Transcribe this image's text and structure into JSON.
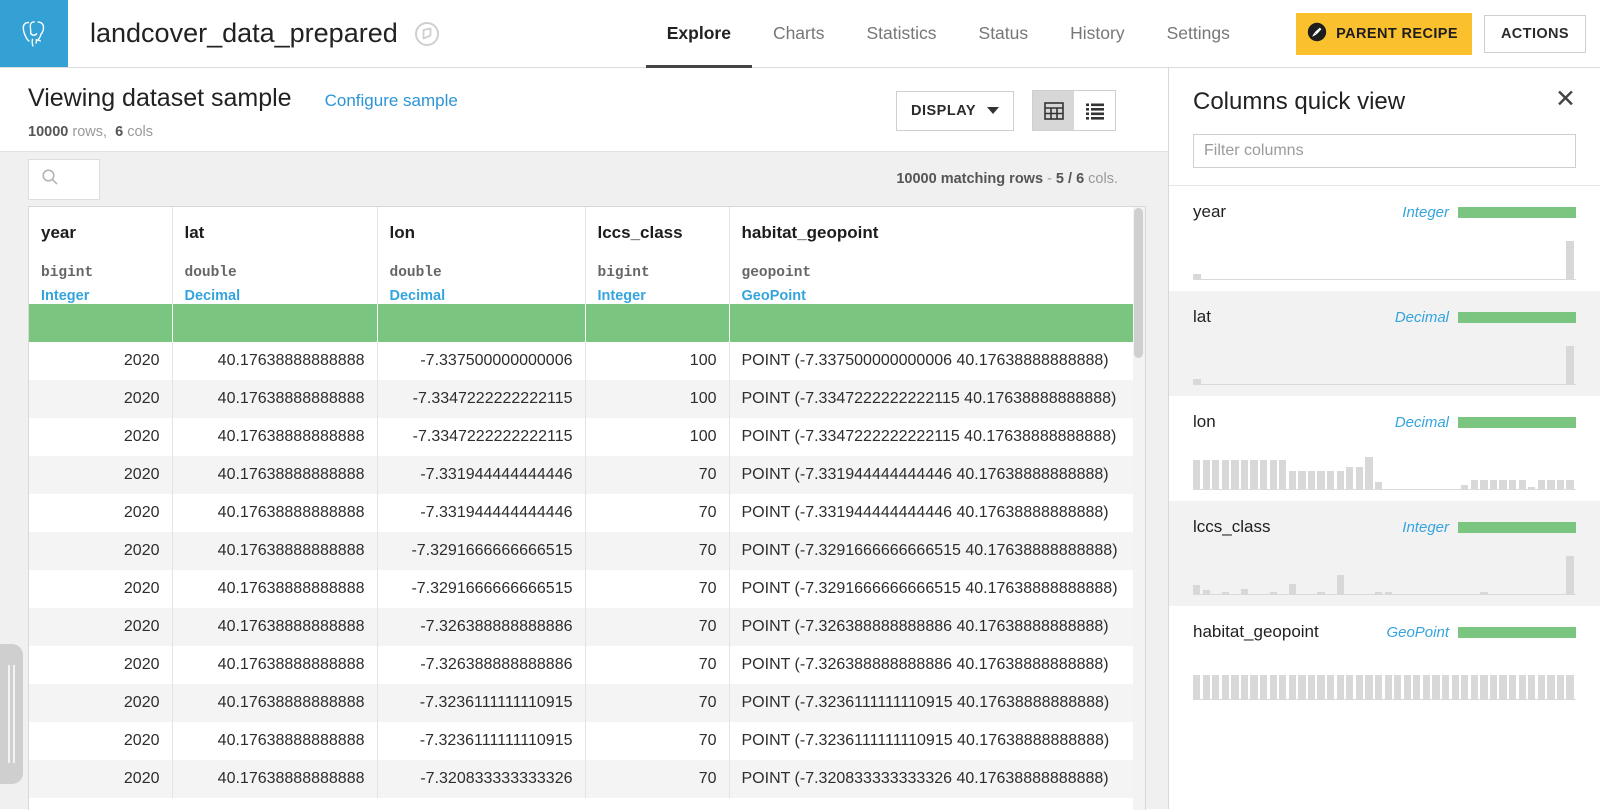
{
  "topbar": {
    "logo_icon": "postgres-elephant-icon",
    "logo_bg": "#33a1d4",
    "dataset_title": "landcover_data_prepared",
    "flag_icon": "dataset-flag-icon",
    "tabs": [
      {
        "label": "Explore",
        "active": true
      },
      {
        "label": "Charts",
        "active": false
      },
      {
        "label": "Statistics",
        "active": false
      },
      {
        "label": "Status",
        "active": false
      },
      {
        "label": "History",
        "active": false
      },
      {
        "label": "Settings",
        "active": false
      }
    ],
    "parent_recipe_label": "PARENT RECIPE",
    "parent_recipe_color": "#fbc02d",
    "actions_label": "ACTIONS"
  },
  "subheader": {
    "sample_title": "Viewing dataset sample",
    "configure_link": "Configure sample",
    "rows_count": "10000",
    "rows_word": "rows,",
    "cols_count": "6",
    "cols_word": "cols",
    "display_label": "DISPLAY",
    "view_grid_icon": "grid-view-icon",
    "view_list_icon": "list-view-icon",
    "active_view": "grid"
  },
  "toolbar": {
    "search_icon": "search-icon",
    "search_value": "",
    "matching_rows": "10000 matching rows",
    "separator": "-",
    "cols_shown": "5 / 6",
    "cols_suffix": "cols."
  },
  "table": {
    "columns": [
      {
        "name": "year",
        "sql_type": "bigint",
        "meaning": "Integer",
        "align": "num"
      },
      {
        "name": "lat",
        "sql_type": "double",
        "meaning": "Decimal",
        "align": "num"
      },
      {
        "name": "lon",
        "sql_type": "double",
        "meaning": "Decimal",
        "align": "num"
      },
      {
        "name": "lccs_class",
        "sql_type": "bigint",
        "meaning": "Integer",
        "align": "num"
      },
      {
        "name": "habitat_geopoint",
        "sql_type": "geopoint",
        "meaning": "GeoPoint",
        "align": "txt"
      }
    ],
    "quality_bar_color": "#7ac57f",
    "rows": [
      [
        "2020",
        "40.17638888888888",
        "-7.337500000000006",
        "100",
        "POINT (-7.337500000000006 40.17638888888888)"
      ],
      [
        "2020",
        "40.17638888888888",
        "-7.3347222222222115",
        "100",
        "POINT (-7.3347222222222115 40.17638888888888)"
      ],
      [
        "2020",
        "40.17638888888888",
        "-7.3347222222222115",
        "100",
        "POINT (-7.3347222222222115 40.17638888888888)"
      ],
      [
        "2020",
        "40.17638888888888",
        "-7.331944444444446",
        "70",
        "POINT (-7.331944444444446 40.17638888888888)"
      ],
      [
        "2020",
        "40.17638888888888",
        "-7.331944444444446",
        "70",
        "POINT (-7.331944444444446 40.17638888888888)"
      ],
      [
        "2020",
        "40.17638888888888",
        "-7.3291666666666515",
        "70",
        "POINT (-7.3291666666666515 40.17638888888888)"
      ],
      [
        "2020",
        "40.17638888888888",
        "-7.3291666666666515",
        "70",
        "POINT (-7.3291666666666515 40.17638888888888)"
      ],
      [
        "2020",
        "40.17638888888888",
        "-7.326388888888886",
        "70",
        "POINT (-7.326388888888886 40.17638888888888)"
      ],
      [
        "2020",
        "40.17638888888888",
        "-7.326388888888886",
        "70",
        "POINT (-7.326388888888886 40.17638888888888)"
      ],
      [
        "2020",
        "40.17638888888888",
        "-7.3236111111110915",
        "70",
        "POINT (-7.3236111111110915 40.17638888888888)"
      ],
      [
        "2020",
        "40.17638888888888",
        "-7.3236111111110915",
        "70",
        "POINT (-7.3236111111110915 40.17638888888888)"
      ],
      [
        "2020",
        "40.17638888888888",
        "-7.320833333333326",
        "70",
        "POINT (-7.320833333333326 40.17638888888888)"
      ]
    ]
  },
  "rightpanel": {
    "title": "Columns quick view",
    "close_icon": "close-icon",
    "filter_placeholder": "Filter columns",
    "filter_value": "",
    "items": [
      {
        "name": "year",
        "meaning": "Integer",
        "spark": [
          0,
          0,
          0,
          0,
          0,
          0,
          0,
          0,
          0,
          0,
          0,
          0,
          0,
          0,
          0,
          0,
          0,
          0,
          0,
          0,
          0,
          0,
          0,
          0,
          0,
          0,
          0,
          0,
          0,
          0,
          0,
          0,
          0,
          0,
          0,
          0,
          0,
          0,
          0,
          95
        ],
        "first_tick": 7
      },
      {
        "name": "lat",
        "meaning": "Decimal",
        "spark": [
          0,
          0,
          0,
          0,
          0,
          0,
          0,
          0,
          0,
          0,
          0,
          0,
          0,
          0,
          0,
          0,
          0,
          0,
          0,
          0,
          0,
          0,
          0,
          0,
          0,
          0,
          0,
          0,
          0,
          0,
          0,
          0,
          0,
          0,
          0,
          0,
          0,
          0,
          0,
          95
        ],
        "first_tick": 7
      },
      {
        "name": "lon",
        "meaning": "Decimal",
        "spark": [
          72,
          72,
          72,
          72,
          72,
          72,
          72,
          72,
          72,
          72,
          45,
          45,
          45,
          45,
          45,
          45,
          55,
          55,
          80,
          18,
          0,
          0,
          0,
          0,
          0,
          0,
          0,
          0,
          10,
          22,
          22,
          22,
          22,
          22,
          22,
          6,
          22,
          22,
          22,
          22
        ]
      },
      {
        "name": "lccs_class",
        "meaning": "Integer",
        "spark": [
          22,
          10,
          0,
          6,
          0,
          12,
          0,
          0,
          5,
          0,
          25,
          0,
          0,
          5,
          0,
          48,
          0,
          0,
          0,
          5,
          5,
          0,
          0,
          0,
          0,
          0,
          0,
          0,
          0,
          0,
          5,
          0,
          0,
          0,
          0,
          0,
          0,
          0,
          0,
          95
        ]
      },
      {
        "name": "habitat_geopoint",
        "meaning": "GeoPoint",
        "spark": [
          60,
          60,
          60,
          60,
          60,
          60,
          60,
          60,
          60,
          60,
          60,
          60,
          60,
          60,
          60,
          60,
          60,
          60,
          60,
          60,
          60,
          60,
          60,
          60,
          60,
          60,
          60,
          60,
          60,
          60,
          60,
          60,
          60,
          60,
          60,
          60,
          60,
          60,
          60,
          60
        ]
      }
    ],
    "quality_bar_color": "#7ac57f"
  }
}
